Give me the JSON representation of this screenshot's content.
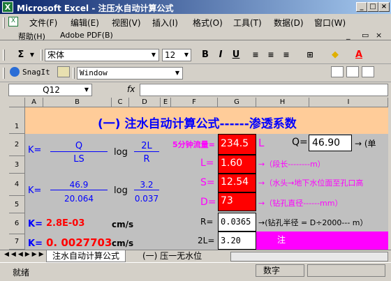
{
  "window": {
    "title": "Microsoft Excel - 注压水自动计算公式",
    "min": "_",
    "max": "□",
    "close": "×"
  },
  "menu": [
    "文件(F)",
    "编辑(E)",
    "视图(V)",
    "插入(I)",
    "格式(O)",
    "工具(T)",
    "数据(D)",
    "窗口(W)"
  ],
  "menu2": [
    "帮助(H)",
    "Adobe PDF(B)"
  ],
  "toolbar": {
    "font": "宋体",
    "size": "12",
    "bold": "B",
    "italic": "I",
    "underline": "U",
    "sigma": "Σ",
    "snagit": "SnagIt",
    "window": "Window"
  },
  "namebox": "Q12",
  "fx": "fx",
  "columns": [
    "A",
    "B",
    "C",
    "D",
    "E",
    "F",
    "G",
    "H",
    "I"
  ],
  "rows": [
    "1",
    "2",
    "3",
    "4",
    "5",
    "6",
    "7"
  ],
  "sheet": {
    "title": "(一)  注水自动计算公式------渗透系数",
    "k1": "K=",
    "q": "Q",
    "ls": "LS",
    "log1": "log",
    "twoL": "2L",
    "r": "R",
    "k2": "K=",
    "num": "46.9",
    "den": "20.064",
    "log2": "log",
    "n32": "3.2",
    "n0037": "0.037",
    "k3": "K=",
    "k3v": "2.8E-03",
    "unit1": "cm/s",
    "k4": "K=",
    "k4v": "0. 0027703",
    "unit2": "cm/s",
    "flow_label": "5分钟流量=",
    "flow_val": "234.5",
    "L1": "L",
    "Lp": "L=",
    "Lval": "1.60",
    "Lnote": "→（段长--------m）",
    "Sp": "S=",
    "Sval": "12.54",
    "Snote": "→（水头→地下水位面至孔口高",
    "Dp": "D=",
    "Dval": "73",
    "Dnote": "→（钻孔直径------mm）",
    "Rp": "R=",
    "Rval": "0.0365",
    "Rnote": "→(钻孔半径 = D÷2000--- m）",
    "twoLp": "2L=",
    "twoLval": "3.20",
    "note": "注",
    "Qp": "Q=",
    "Qval": "46.90",
    "Qnote": "→ (单"
  },
  "tabs": [
    "注水自动计算公式",
    "(一) 压一无水位"
  ],
  "status": {
    "left": "就绪",
    "right": "数字"
  }
}
